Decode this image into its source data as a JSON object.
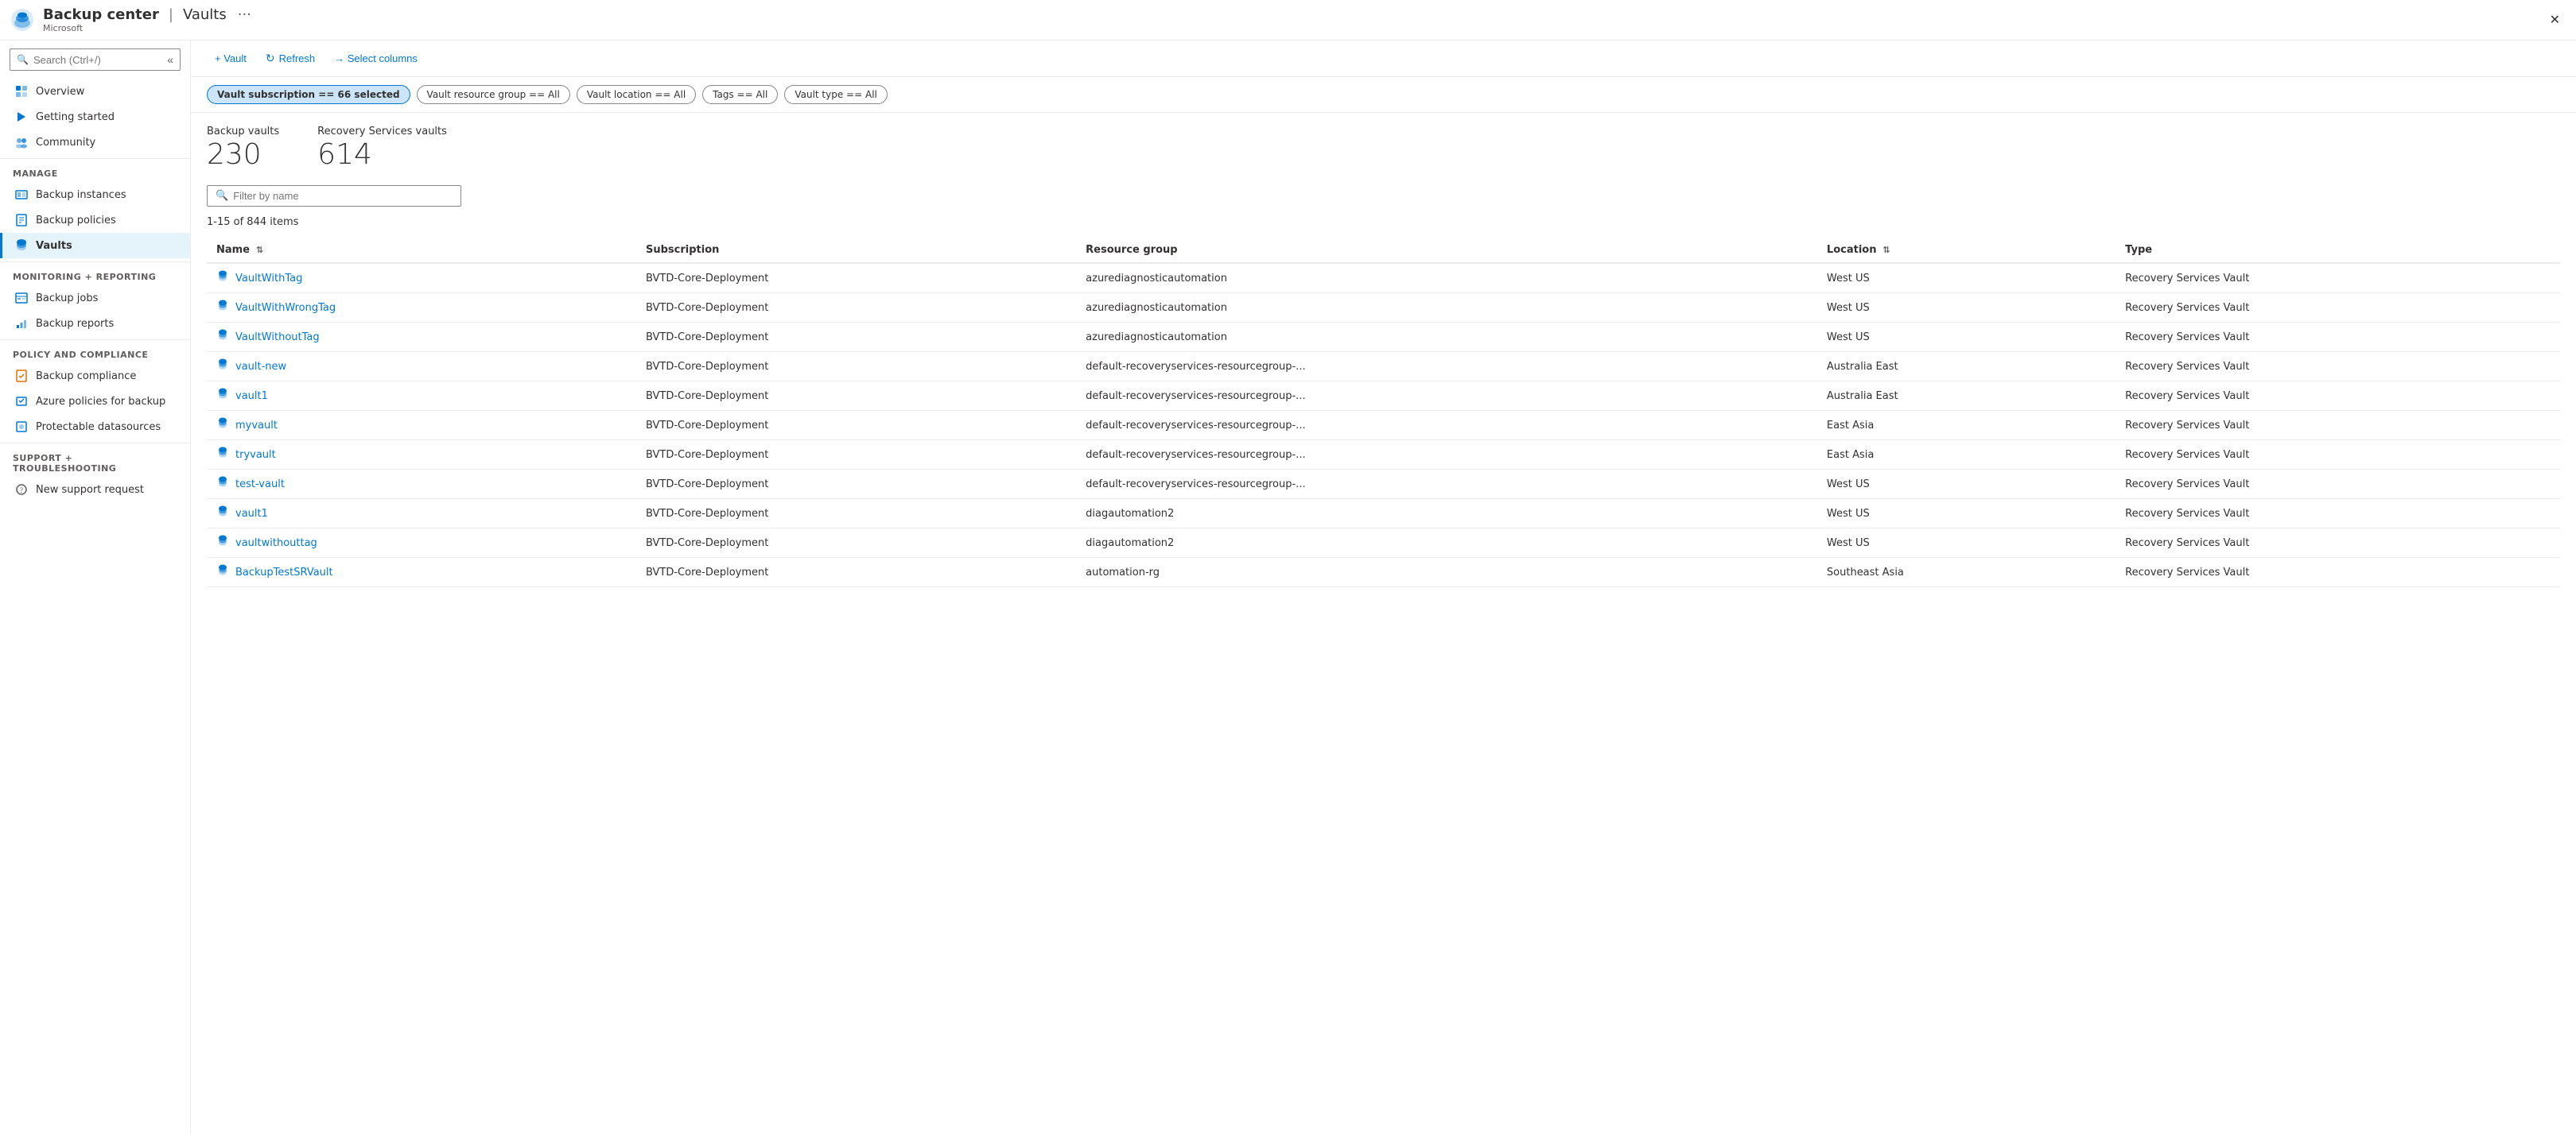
{
  "titleBar": {
    "appName": "Backup center",
    "separator": "|",
    "pageName": "Vaults",
    "company": "Microsoft",
    "closeLabel": "✕"
  },
  "sidebar": {
    "searchPlaceholder": "Search (Ctrl+/)",
    "navItems": [
      {
        "id": "overview",
        "label": "Overview",
        "section": null,
        "icon": "overview"
      },
      {
        "id": "getting-started",
        "label": "Getting started",
        "section": null,
        "icon": "start"
      },
      {
        "id": "community",
        "label": "Community",
        "section": null,
        "icon": "community"
      },
      {
        "id": "manage-header",
        "label": "Manage",
        "section": "header"
      },
      {
        "id": "backup-instances",
        "label": "Backup instances",
        "section": "manage",
        "icon": "instances"
      },
      {
        "id": "backup-policies",
        "label": "Backup policies",
        "section": "manage",
        "icon": "policies"
      },
      {
        "id": "vaults",
        "label": "Vaults",
        "section": "manage",
        "icon": "vaults",
        "active": true
      },
      {
        "id": "monitoring-header",
        "label": "Monitoring + reporting",
        "section": "header"
      },
      {
        "id": "backup-jobs",
        "label": "Backup jobs",
        "section": "monitoring",
        "icon": "jobs"
      },
      {
        "id": "backup-reports",
        "label": "Backup reports",
        "section": "monitoring",
        "icon": "reports"
      },
      {
        "id": "policy-header",
        "label": "Policy and compliance",
        "section": "header"
      },
      {
        "id": "backup-compliance",
        "label": "Backup compliance",
        "section": "policy",
        "icon": "compliance"
      },
      {
        "id": "azure-policies",
        "label": "Azure policies for backup",
        "section": "policy",
        "icon": "azure-policy"
      },
      {
        "id": "protectable-datasources",
        "label": "Protectable datasources",
        "section": "policy",
        "icon": "datasources"
      },
      {
        "id": "support-header",
        "label": "Support + troubleshooting",
        "section": "header"
      },
      {
        "id": "new-support-request",
        "label": "New support request",
        "section": "support",
        "icon": "support"
      }
    ]
  },
  "toolbar": {
    "vaultLabel": "+ Vault",
    "refreshLabel": "Refresh",
    "selectColumnsLabel": "→ Select columns"
  },
  "filters": [
    {
      "id": "subscription",
      "label": "Vault subscription == 66 selected",
      "active": true
    },
    {
      "id": "resourceGroup",
      "label": "Vault resource group == All",
      "active": false
    },
    {
      "id": "location",
      "label": "Vault location == All",
      "active": false
    },
    {
      "id": "tags",
      "label": "Tags == All",
      "active": false
    },
    {
      "id": "vaultType",
      "label": "Vault type == All",
      "active": false
    }
  ],
  "stats": {
    "backupVaults": {
      "label": "Backup vaults",
      "value": "230"
    },
    "recoveryVaults": {
      "label": "Recovery Services vaults",
      "value": "614"
    }
  },
  "filterInput": {
    "placeholder": "Filter by name"
  },
  "itemsCount": "1-15 of 844 items",
  "table": {
    "columns": [
      {
        "id": "name",
        "label": "Name",
        "sortable": true
      },
      {
        "id": "subscription",
        "label": "Subscription",
        "sortable": false
      },
      {
        "id": "resourceGroup",
        "label": "Resource group",
        "sortable": false
      },
      {
        "id": "location",
        "label": "Location",
        "sortable": true
      },
      {
        "id": "type",
        "label": "Type",
        "sortable": false
      }
    ],
    "rows": [
      {
        "name": "VaultWithTag",
        "subscription": "BVTD-Core-Deployment",
        "resourceGroup": "azurediagnosticautomation",
        "location": "West US",
        "type": "Recovery Services Vault"
      },
      {
        "name": "VaultWithWrongTag",
        "subscription": "BVTD-Core-Deployment",
        "resourceGroup": "azurediagnosticautomation",
        "location": "West US",
        "type": "Recovery Services Vault"
      },
      {
        "name": "VaultWithoutTag",
        "subscription": "BVTD-Core-Deployment",
        "resourceGroup": "azurediagnosticautomation",
        "location": "West US",
        "type": "Recovery Services Vault"
      },
      {
        "name": "vault-new",
        "subscription": "BVTD-Core-Deployment",
        "resourceGroup": "default-recoveryservices-resourcegroup-...",
        "location": "Australia East",
        "type": "Recovery Services Vault"
      },
      {
        "name": "vault1",
        "subscription": "BVTD-Core-Deployment",
        "resourceGroup": "default-recoveryservices-resourcegroup-...",
        "location": "Australia East",
        "type": "Recovery Services Vault"
      },
      {
        "name": "myvault",
        "subscription": "BVTD-Core-Deployment",
        "resourceGroup": "default-recoveryservices-resourcegroup-...",
        "location": "East Asia",
        "type": "Recovery Services Vault"
      },
      {
        "name": "tryvault",
        "subscription": "BVTD-Core-Deployment",
        "resourceGroup": "default-recoveryservices-resourcegroup-...",
        "location": "East Asia",
        "type": "Recovery Services Vault"
      },
      {
        "name": "test-vault",
        "subscription": "BVTD-Core-Deployment",
        "resourceGroup": "default-recoveryservices-resourcegroup-...",
        "location": "West US",
        "type": "Recovery Services Vault"
      },
      {
        "name": "vault1",
        "subscription": "BVTD-Core-Deployment",
        "resourceGroup": "diagautomation2",
        "location": "West US",
        "type": "Recovery Services Vault"
      },
      {
        "name": "vaultwithouttag",
        "subscription": "BVTD-Core-Deployment",
        "resourceGroup": "diagautomation2",
        "location": "West US",
        "type": "Recovery Services Vault"
      },
      {
        "name": "BackupTestSRVault",
        "subscription": "BVTD-Core-Deployment",
        "resourceGroup": "automation-rg",
        "location": "Southeast Asia",
        "type": "Recovery Services Vault"
      }
    ]
  }
}
